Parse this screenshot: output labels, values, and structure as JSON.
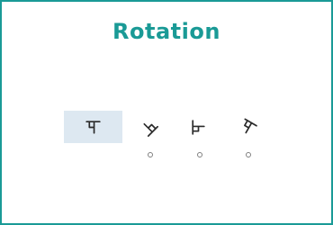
{
  "title": "Rotation",
  "accent_color": "#1a9a96",
  "selected_bg_color": "#dde8f1",
  "glyph_icon": "rotated-hindi-character-ma-icon",
  "options": [
    {
      "angle": 0,
      "selected": true
    },
    {
      "angle": 135,
      "selected": false
    },
    {
      "angle": 270,
      "selected": false
    },
    {
      "angle": 30,
      "selected": false
    }
  ]
}
